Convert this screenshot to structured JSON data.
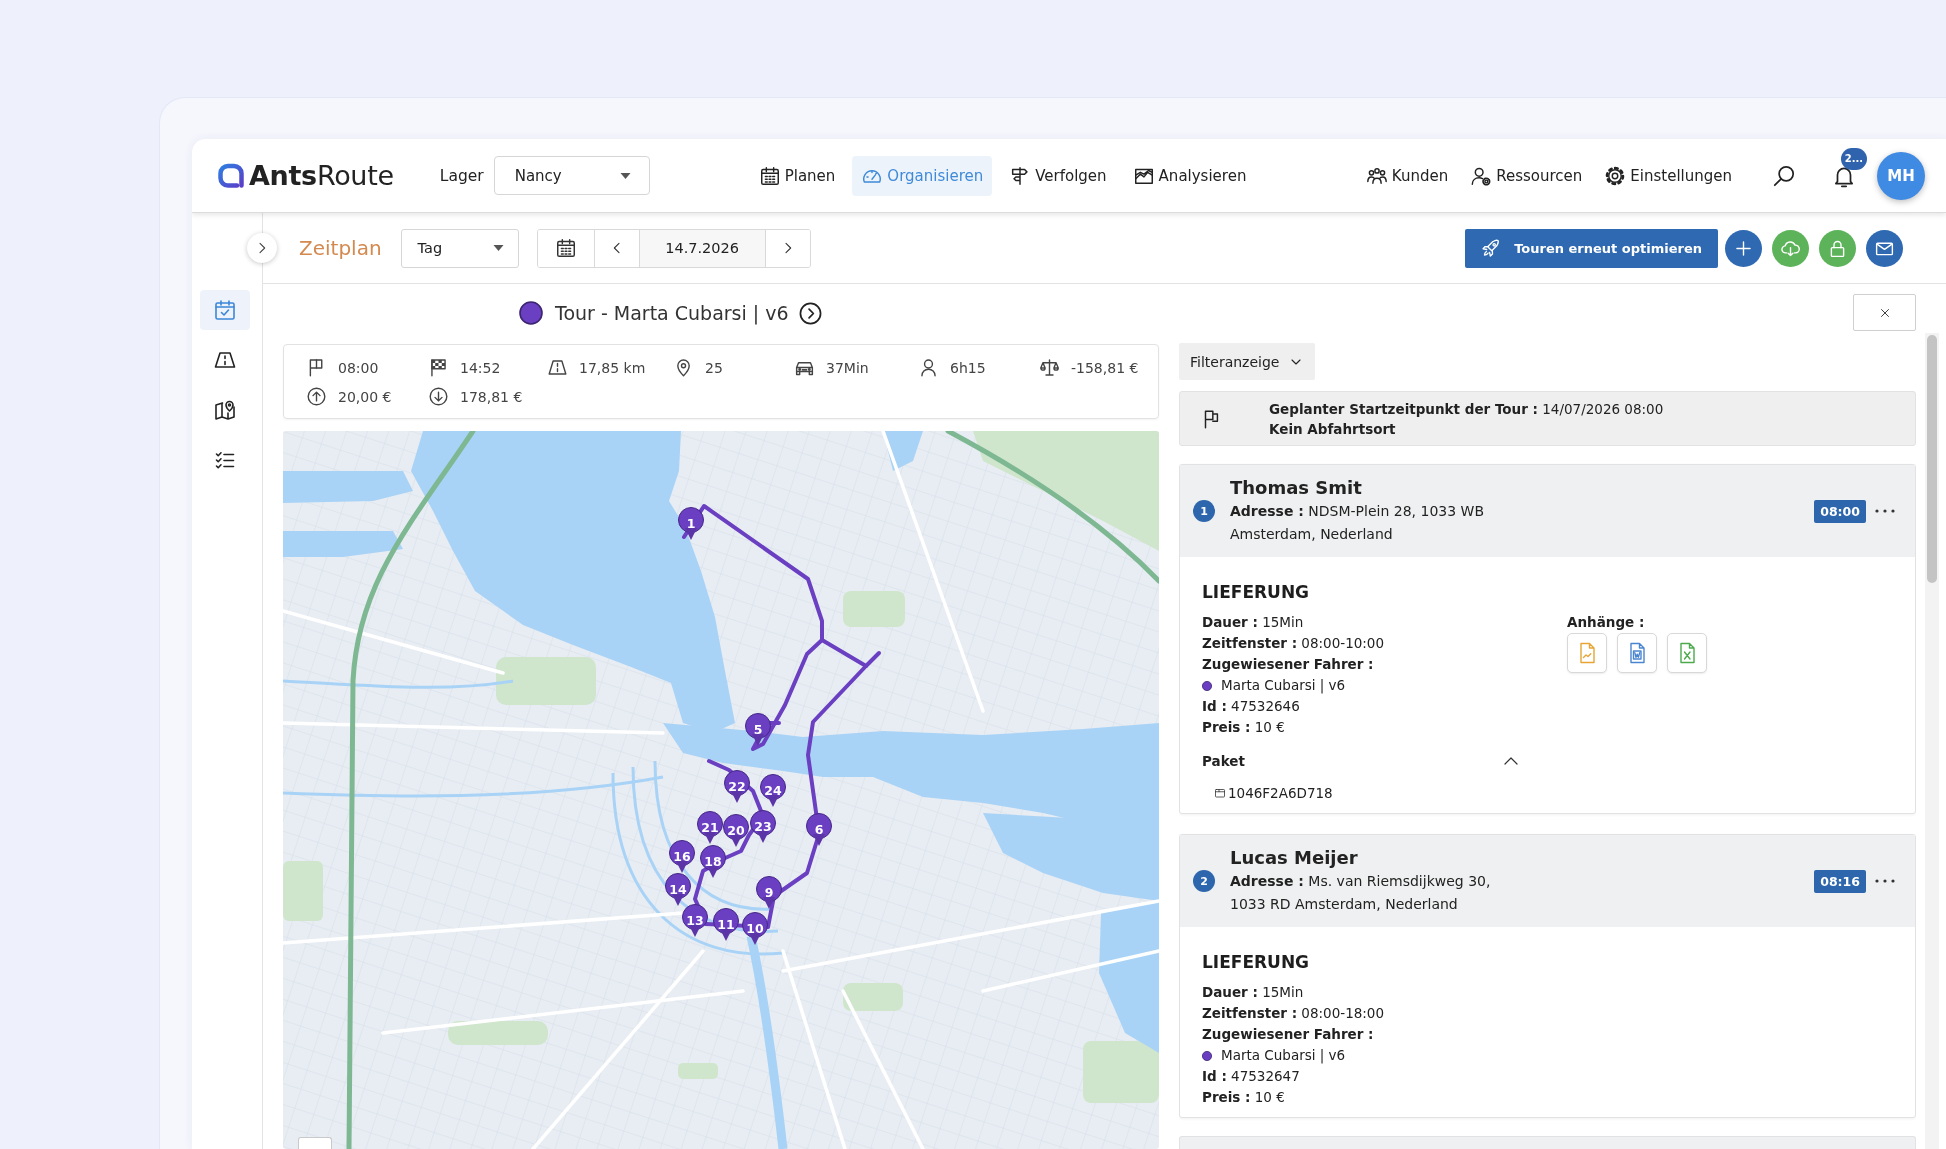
{
  "header": {
    "logo": "**Ants**Route",
    "warehouse_label": "Lager",
    "warehouse": "Nancy",
    "nav": [
      {
        "label": "Planen",
        "selected": false
      },
      {
        "label": "Organisieren",
        "selected": true
      },
      {
        "label": "Verfolgen",
        "selected": false
      },
      {
        "label": "Analysieren",
        "selected": false
      }
    ],
    "nav_right": [
      {
        "label": "Kunden"
      },
      {
        "label": "Ressourcen"
      },
      {
        "label": "Einstellungen"
      }
    ],
    "notification_count": "2...",
    "avatar": "MH"
  },
  "sidebar": {
    "items": [
      {
        "selected": true
      },
      {
        "selected": false
      },
      {
        "selected": false
      },
      {
        "selected": false
      }
    ]
  },
  "toolbar": {
    "title": "Zeitplan",
    "view": "Tag",
    "date": "14.7.2026",
    "optimize_button": "Touren erneut optimieren"
  },
  "tour": {
    "title": "Tour - Marta Cubarsi | v6",
    "stats": [
      "08:00",
      "14:52",
      "17,85 km",
      "25",
      "37Min",
      "6h15",
      "-158,81 €",
      "20,00 €",
      "178,81 €"
    ]
  },
  "map": {
    "pins": [
      {
        "label": "1"
      },
      {
        "label": "5"
      },
      {
        "label": "22"
      },
      {
        "label": "24"
      },
      {
        "label": "21"
      },
      {
        "label": "20"
      },
      {
        "label": "23"
      },
      {
        "label": "6"
      },
      {
        "label": "16"
      },
      {
        "label": "18"
      },
      {
        "label": "14"
      },
      {
        "label": "9"
      },
      {
        "label": "13"
      },
      {
        "label": "11"
      },
      {
        "label": "10"
      }
    ]
  },
  "panel": {
    "filter_button": "Filteranzeige",
    "start": {
      "text": "**Geplanter Startzeitpunkt der Tour :** 14/07/2026 08:00",
      "note": "Kein Abfahrtsort"
    },
    "stops": [
      {
        "number": "1",
        "name": "Thomas Smit",
        "address": "**Adresse :** NDSM-Plein 28, 1033 WB\nAmsterdam, Nederland",
        "time": "08:00",
        "type": "LIEFERUNG",
        "details": [
          {
            "kind": "field",
            "text": "**Dauer :** 15Min"
          },
          {
            "kind": "field",
            "text": "**Zeitfenster :** 08:00-10:00"
          },
          {
            "kind": "heading",
            "text": "Zugewiesener Fahrer :"
          },
          {
            "kind": "driver",
            "text": "Marta Cubarsi | v6"
          },
          {
            "kind": "field",
            "text": "**Id :** 47532646"
          },
          {
            "kind": "field",
            "text": "**Preis :** 10 €"
          }
        ],
        "attachments": {
          "label": "Anhänge :",
          "files": [
            {
              "kind": "image"
            },
            {
              "kind": "word"
            },
            {
              "kind": "spreadsheet"
            }
          ]
        },
        "package": {
          "label": "Paket",
          "expanded": true,
          "items": [
            "1046F2A6D718"
          ]
        }
      },
      {
        "number": "2",
        "name": "Lucas Meijer",
        "address": "**Adresse :** Ms. van Riemsdijkweg 30,\n1033 RD Amsterdam, Nederland",
        "time": "08:16",
        "type": "LIEFERUNG",
        "details": [
          {
            "kind": "field",
            "text": "**Dauer :** 15Min"
          },
          {
            "kind": "field",
            "text": "**Zeitfenster :** 08:00-18:00"
          },
          {
            "kind": "heading",
            "text": "Zugewiesener Fahrer :"
          },
          {
            "kind": "driver",
            "text": "Marta Cubarsi | v6"
          },
          {
            "kind": "field",
            "text": "**Id :** 47532647"
          },
          {
            "kind": "field",
            "text": "**Preis :** 10 €"
          }
        ]
      }
    ]
  }
}
